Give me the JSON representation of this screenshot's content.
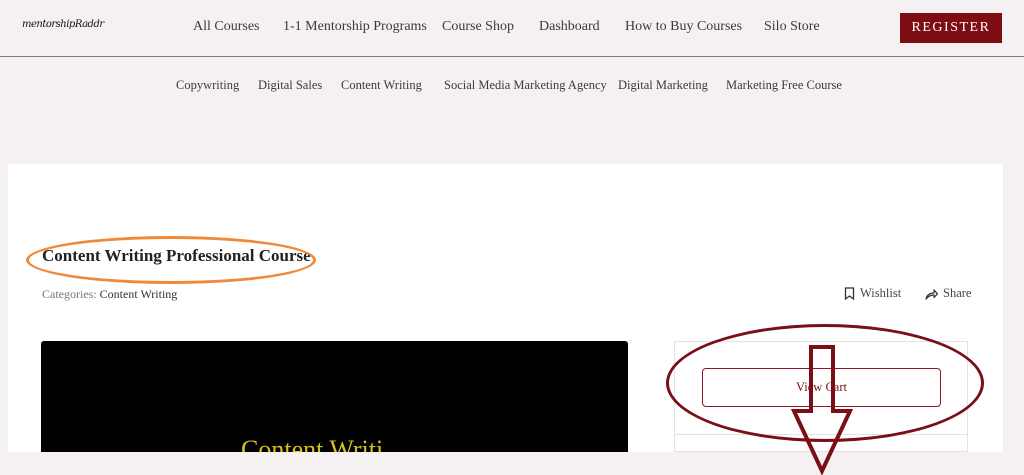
{
  "header": {
    "logo_text": "mentorshipRaddr",
    "nav": [
      {
        "label": "All Courses"
      },
      {
        "label": "1-1 Mentorship Programs"
      },
      {
        "label": "Course Shop"
      },
      {
        "label": "Dashboard"
      },
      {
        "label": "How to Buy Courses"
      },
      {
        "label": "Silo Store"
      }
    ],
    "register_label": "REGISTER"
  },
  "subnav": [
    {
      "label": "Copywriting"
    },
    {
      "label": "Digital Sales"
    },
    {
      "label": "Content Writing"
    },
    {
      "label": "Social Media Marketing Agency"
    },
    {
      "label": "Digital Marketing"
    },
    {
      "label": "Marketing Free Course"
    }
  ],
  "course": {
    "title": "Content Writing Professional Course",
    "categories_label": "Categories:",
    "category": "Content Writing",
    "wishlist_label": "Wishlist",
    "share_label": "Share",
    "video_title": "Content Writi"
  },
  "cart": {
    "view_cart_label": "View Cart"
  },
  "colors": {
    "brand": "#7e0c13",
    "annotation_orange": "#f0883a",
    "annotation_maroon": "#7a0f18",
    "video_text": "#d8c11a"
  }
}
